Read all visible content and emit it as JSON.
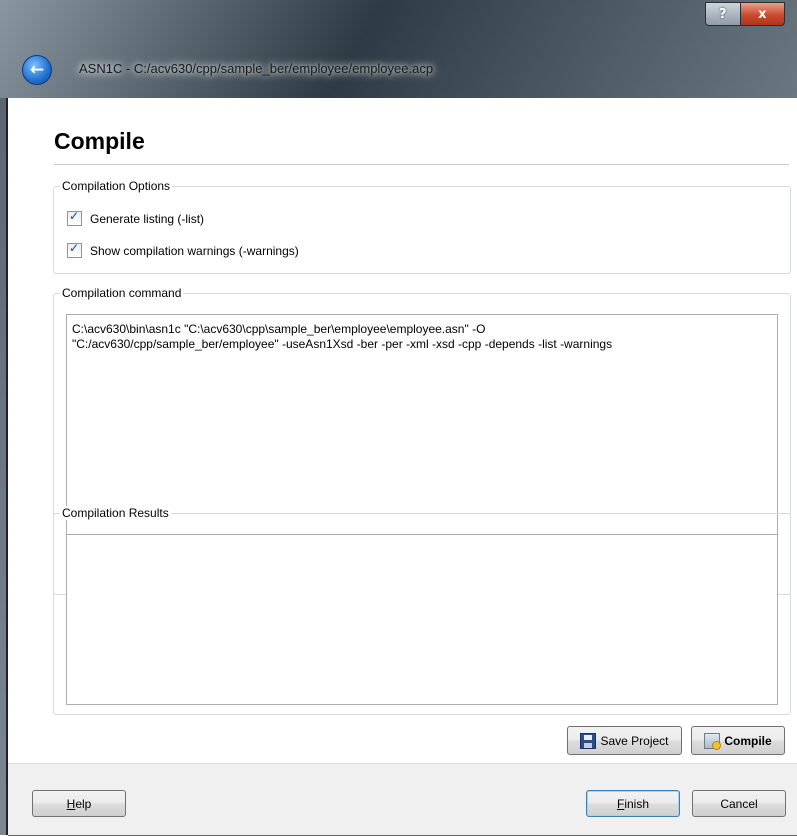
{
  "window": {
    "title": "ASN1C - C:/acv630/cpp/sample_ber/employee/employee.acp",
    "help_glyph": "?",
    "close_glyph": "x",
    "back_glyph": "←"
  },
  "page": {
    "title": "Compile"
  },
  "options": {
    "group_label": "Compilation Options",
    "items": [
      {
        "label": "Generate listing (-list)",
        "checked": true
      },
      {
        "label": "Show compilation warnings (-warnings)",
        "checked": true
      }
    ]
  },
  "command": {
    "group_label": "Compilation command",
    "text": "C:\\acv630\\bin\\asn1c \"C:\\acv630\\cpp\\sample_ber\\employee\\employee.asn\" -O\n\"C:/acv630/cpp/sample_ber/employee\" -useAsn1Xsd -ber -per -xml -xsd -cpp -depends -list -warnings"
  },
  "results": {
    "group_label": "Compilation Results",
    "text": ""
  },
  "actions": {
    "save_project": "Save Project",
    "compile": "Compile"
  },
  "footer": {
    "help_prefix": "",
    "help_mnemonic": "H",
    "help_rest": "elp",
    "finish_mnemonic": "F",
    "finish_rest": "inish",
    "cancel": "Cancel"
  },
  "checkmark_glyph": "✓"
}
